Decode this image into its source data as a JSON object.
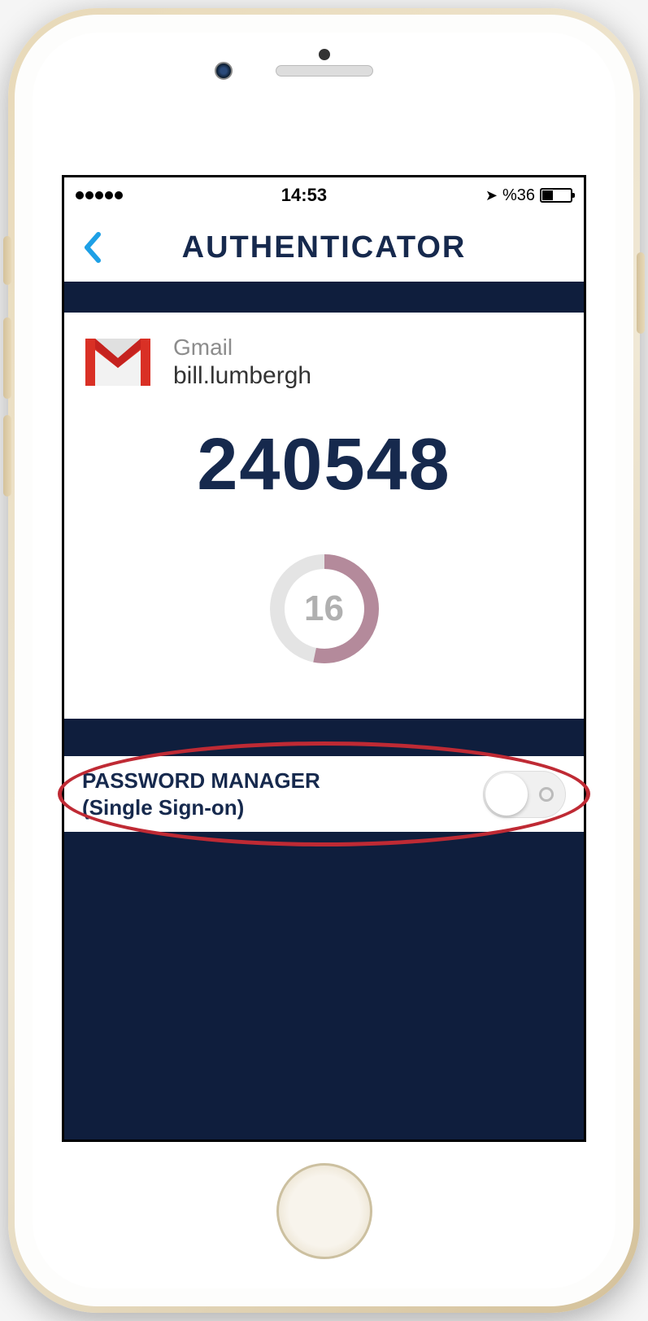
{
  "status": {
    "time": "14:53",
    "battery_text": "%36"
  },
  "nav": {
    "title": "AUTHENTICATOR"
  },
  "account": {
    "service": "Gmail",
    "username": "bill.lumbergh",
    "code": "240548",
    "seconds_remaining": "16"
  },
  "pm": {
    "label_line1": "PASSWORD MANAGER",
    "label_line2": "(Single Sign-on)"
  }
}
